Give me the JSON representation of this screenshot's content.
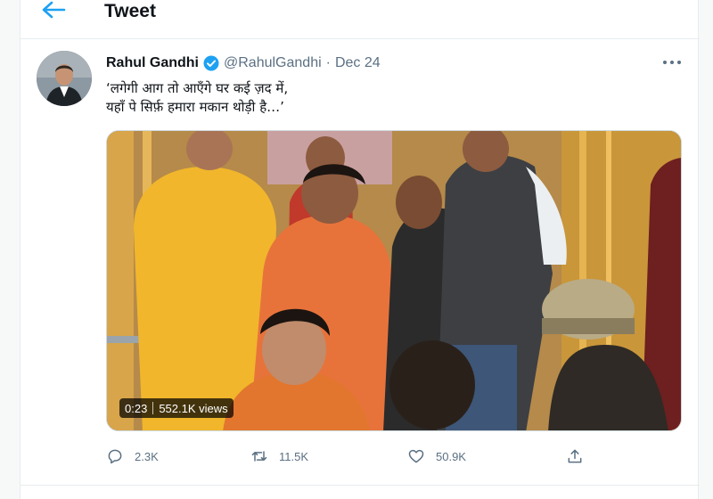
{
  "header": {
    "title": "Tweet",
    "back_icon": "arrow-left-icon"
  },
  "tweet": {
    "author_name": "Rahul Gandhi",
    "handle": "@RahulGandhi",
    "separator": "·",
    "date": "Dec 24",
    "verified": true,
    "text_line1": "‘लगेगी आग तो आएँगे घर कई ज़द में,",
    "text_line2": "यहाँ पे सिर्फ़ हमारा मकान थोड़ी है…’",
    "more_icon": "more-horizontal-icon"
  },
  "video": {
    "duration": "0:23",
    "views": "552.1K views"
  },
  "actions": {
    "replies": "2.3K",
    "retweets": "11.5K",
    "likes": "50.9K"
  },
  "colors": {
    "accent": "#1da1f2",
    "muted": "#5b7083",
    "border": "#e6ecf0"
  }
}
